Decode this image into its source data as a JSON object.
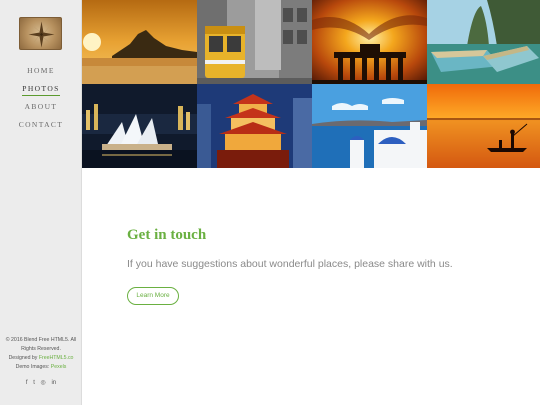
{
  "nav": {
    "items": [
      {
        "label": "HOME",
        "active": false
      },
      {
        "label": "PHOTOS",
        "active": true
      },
      {
        "label": "ABOUT",
        "active": false
      },
      {
        "label": "CONTACT",
        "active": false
      }
    ]
  },
  "footer": {
    "copyright": "© 2016 Blend Free HTML5. All Rights Reserved.",
    "designed_by_prefix": "Designed by ",
    "designed_by_link": "FreeHTML5.co",
    "demo_images_prefix": "Demo Images: ",
    "demo_images_link": "Pexels"
  },
  "social": [
    "f",
    "t",
    "◎",
    "in"
  ],
  "gallery": {
    "tiles": [
      {
        "subject": "rio-sunset"
      },
      {
        "subject": "lisbon-tram"
      },
      {
        "subject": "brandenburg-gate"
      },
      {
        "subject": "boats-limestone-islands"
      },
      {
        "subject": "sydney-opera-house"
      },
      {
        "subject": "chinese-temple"
      },
      {
        "subject": "santorini"
      },
      {
        "subject": "fisherman-sunset"
      }
    ]
  },
  "contact": {
    "heading": "Get in touch",
    "text": "If you have suggestions about wonderful places, please share with us.",
    "button_label": "Learn More"
  },
  "colors": {
    "accent": "#6ab041",
    "sidebar_bg": "#ececec",
    "body_text": "#8a8a8a"
  }
}
